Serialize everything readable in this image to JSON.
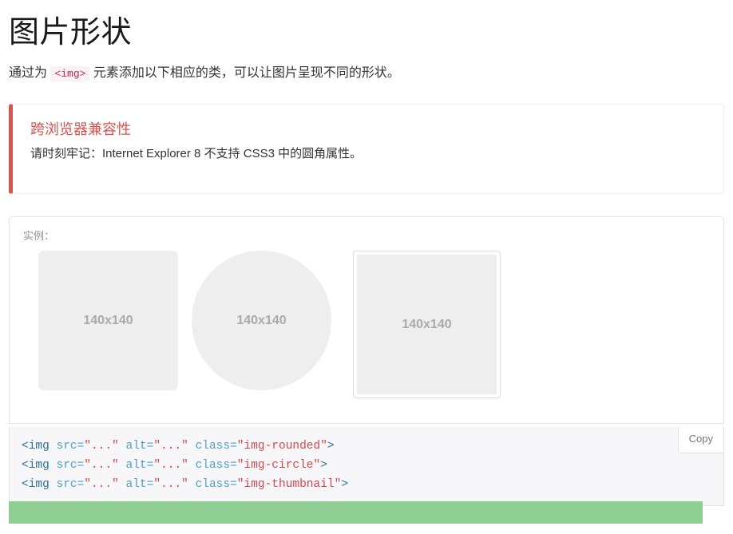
{
  "page": {
    "title": "图片形状",
    "lead_before": "通过为 ",
    "lead_code": "<img>",
    "lead_after": " 元素添加以下相应的类，可以让图片呈现不同的形状。"
  },
  "callout": {
    "title": "跨浏览器兼容性",
    "text": "请时刻牢记：Internet Explorer 8 不支持 CSS3 中的圆角属性。",
    "accent_color": "#d9534f"
  },
  "example": {
    "label": "实例：",
    "shapes": [
      {
        "name": "img-rounded",
        "placeholder_text": "140x140"
      },
      {
        "name": "img-circle",
        "placeholder_text": "140x140"
      },
      {
        "name": "img-thumbnail",
        "placeholder_text": "140x140"
      }
    ]
  },
  "code": {
    "copy_label": "Copy",
    "lines": [
      {
        "tag_open": "<img",
        "attrs": [
          {
            "name": " src=",
            "value": "\"...\""
          },
          {
            "name": " alt=",
            "value": "\"...\""
          },
          {
            "name": " class=",
            "value": "\"img-rounded\""
          }
        ],
        "tag_close": ">"
      },
      {
        "tag_open": "<img",
        "attrs": [
          {
            "name": " src=",
            "value": "\"...\""
          },
          {
            "name": " alt=",
            "value": "\"...\""
          },
          {
            "name": " class=",
            "value": "\"img-circle\""
          }
        ],
        "tag_close": ">"
      },
      {
        "tag_open": "<img",
        "attrs": [
          {
            "name": " src=",
            "value": "\"...\""
          },
          {
            "name": " alt=",
            "value": "\"...\""
          },
          {
            "name": " class=",
            "value": "\"img-thumbnail\""
          }
        ],
        "tag_close": ">"
      }
    ]
  },
  "footer_bar": {
    "color": "#90cf94"
  }
}
